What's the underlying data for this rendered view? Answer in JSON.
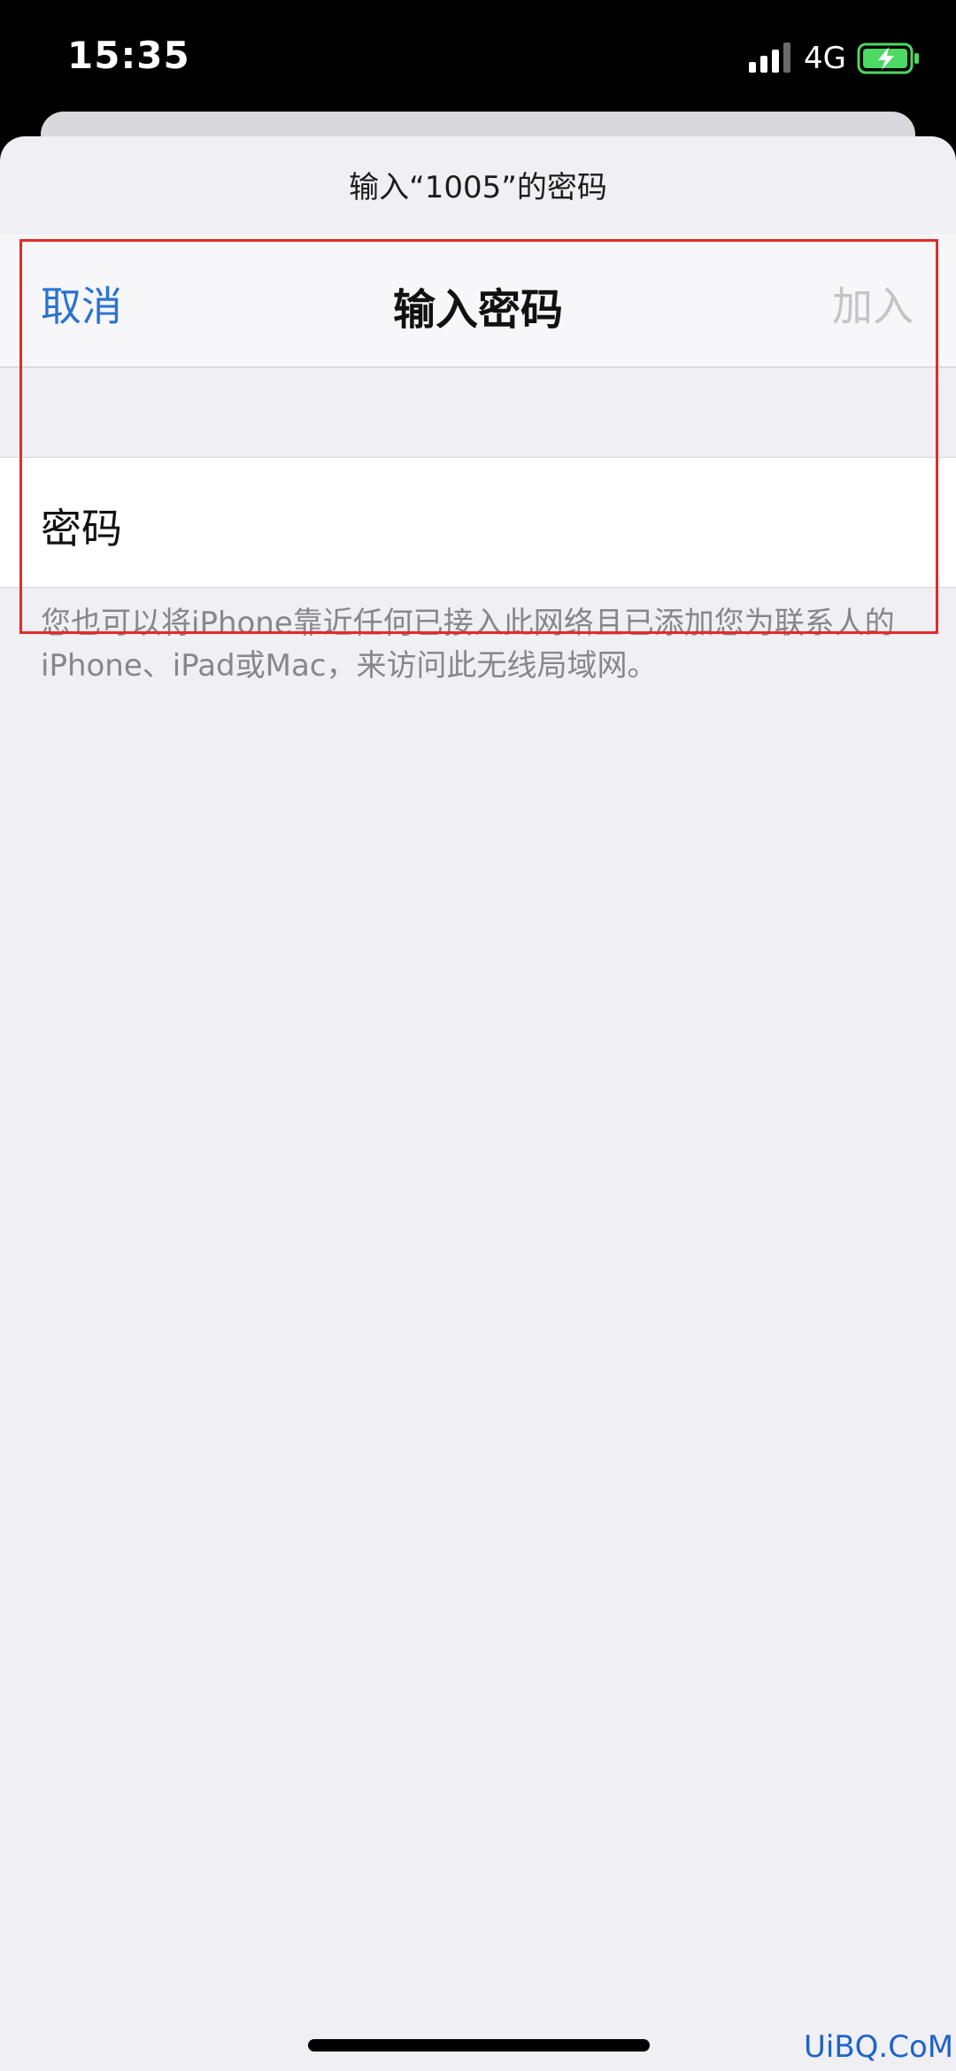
{
  "status_bar": {
    "time": "15:35",
    "network": "4G",
    "signal_icon": "cellular-signal-icon",
    "battery_icon": "battery-charging-icon",
    "battery_color": "#4cd964"
  },
  "dialog": {
    "prompt": "输入“1005”的密码",
    "nav": {
      "cancel_label": "取消",
      "title": "输入密码",
      "join_label": "加入"
    },
    "password_field": {
      "label": "密码",
      "value": ""
    },
    "footnote": "您也可以将iPhone靠近任何已接入此网络且已添加您为联系人的iPhone、iPad或Mac，来访问此无线局域网。"
  },
  "colors": {
    "accent": "#2a72d5",
    "disabled": "#c4c4c6",
    "highlight_box": "#e52a2a",
    "background": "#efeff4"
  },
  "watermark": "UiBQ.CoM"
}
